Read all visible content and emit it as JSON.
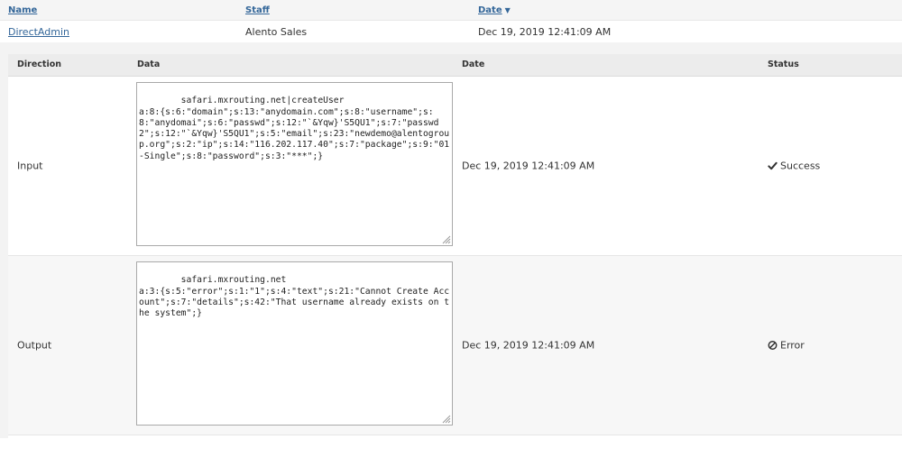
{
  "outer_table": {
    "headers": {
      "name": "Name",
      "staff": "Staff",
      "date": "Date"
    },
    "row": {
      "name": "DirectAdmin",
      "staff": "Alento Sales",
      "date": "Dec 19, 2019 12:41:09 AM"
    }
  },
  "detail_table": {
    "headers": {
      "direction": "Direction",
      "data": "Data",
      "date": "Date",
      "status": "Status"
    },
    "rows": [
      {
        "direction": "Input",
        "data": "safari.mxrouting.net|createUser\na:8:{s:6:\"domain\";s:13:\"anydomain.com\";s:8:\"username\";s:8:\"anydomai\";s:6:\"passwd\";s:12:\"`&Yqw}'S5QU1\";s:7:\"passwd2\";s:12:\"`&Yqw}'S5QU1\";s:5:\"email\";s:23:\"newdemo@alentogroup.org\";s:2:\"ip\";s:14:\"116.202.117.40\";s:7:\"package\";s:9:\"01-Single\";s:8:\"password\";s:3:\"***\";}",
        "date": "Dec 19, 2019 12:41:09 AM",
        "status": "Success",
        "status_icon": "check-icon"
      },
      {
        "direction": "Output",
        "data": "safari.mxrouting.net\na:3:{s:5:\"error\";s:1:\"1\";s:4:\"text\";s:21:\"Cannot Create Account\";s:7:\"details\";s:42:\"That username already exists on the system\";}",
        "date": "Dec 19, 2019 12:41:09 AM",
        "status": "Error",
        "status_icon": "ban-icon"
      }
    ]
  }
}
